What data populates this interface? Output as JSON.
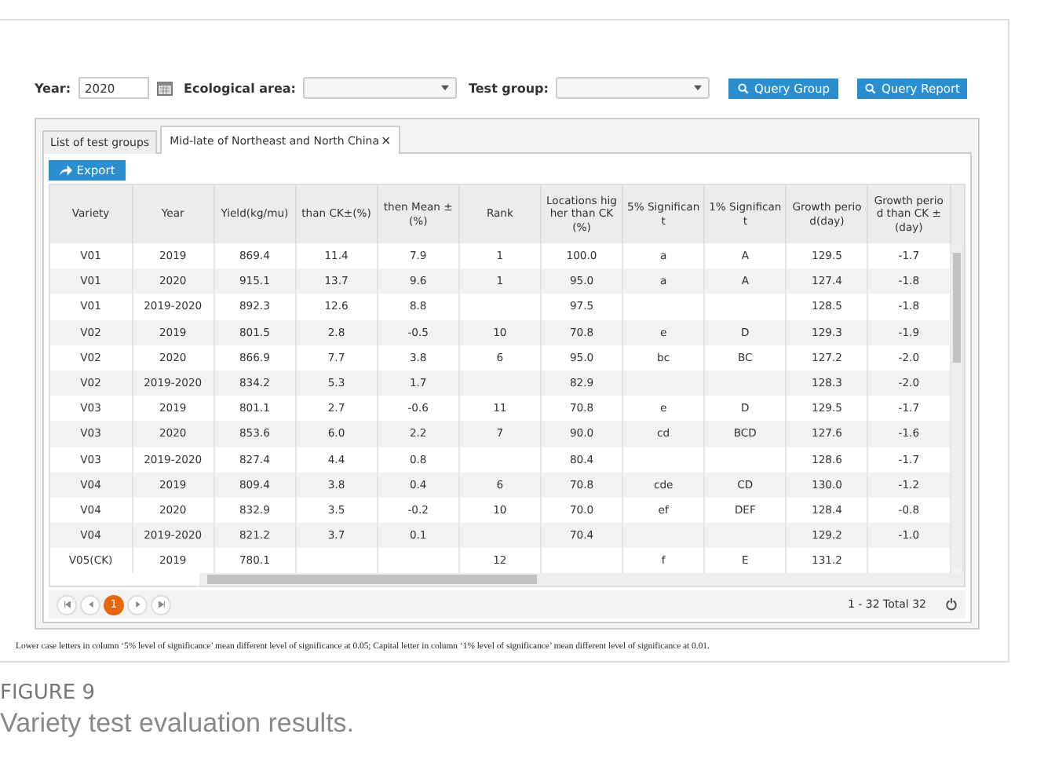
{
  "filters": {
    "year_label": "Year:",
    "year_value": "2020",
    "area_label": "Ecological area:",
    "group_label": "Test group:",
    "buttons": [
      "Query Group",
      "Query Report"
    ]
  },
  "tabs": [
    {
      "label": "List of test groups",
      "selected": false
    },
    {
      "label": "Mid-late of Northeast and North China",
      "selected": true,
      "close": "×"
    }
  ],
  "export_button": "Export",
  "table": {
    "columns": [
      "Variety",
      "Year",
      "Yield(kg/mu)",
      "than CK±(%)",
      "then Mean ±(%)",
      "Rank",
      "Locations higher than CK(%)",
      "5% Significant",
      "1% Significant",
      "Growth period(day)",
      "Growth period than CK ±(day)"
    ],
    "rows": [
      [
        "V01",
        "2019",
        "869.4",
        "11.4",
        "7.9",
        "1",
        "100.0",
        "a",
        "A",
        "129.5",
        "-1.7"
      ],
      [
        "V01",
        "2020",
        "915.1",
        "13.7",
        "9.6",
        "1",
        "95.0",
        "a",
        "A",
        "127.4",
        "-1.8"
      ],
      [
        "V01",
        "2019-2020",
        "892.3",
        "12.6",
        "8.8",
        "",
        "97.5",
        "",
        "",
        "128.5",
        "-1.8"
      ],
      [
        "V02",
        "2019",
        "801.5",
        "2.8",
        "-0.5",
        "10",
        "70.8",
        "e",
        "D",
        "129.3",
        "-1.9"
      ],
      [
        "V02",
        "2020",
        "866.9",
        "7.7",
        "3.8",
        "6",
        "95.0",
        "bc",
        "BC",
        "127.2",
        "-2.0"
      ],
      [
        "V02",
        "2019-2020",
        "834.2",
        "5.3",
        "1.7",
        "",
        "82.9",
        "",
        "",
        "128.3",
        "-2.0"
      ],
      [
        "V03",
        "2019",
        "801.1",
        "2.7",
        "-0.6",
        "11",
        "70.8",
        "e",
        "D",
        "129.5",
        "-1.7"
      ],
      [
        "V03",
        "2020",
        "853.6",
        "6.0",
        "2.2",
        "7",
        "90.0",
        "cd",
        "BCD",
        "127.6",
        "-1.6"
      ],
      [
        "V03",
        "2019-2020",
        "827.4",
        "4.4",
        "0.8",
        "",
        "80.4",
        "",
        "",
        "128.6",
        "-1.7"
      ],
      [
        "V04",
        "2019",
        "809.4",
        "3.8",
        "0.4",
        "6",
        "70.8",
        "cde",
        "CD",
        "130.0",
        "-1.2"
      ],
      [
        "V04",
        "2020",
        "832.9",
        "3.5",
        "-0.2",
        "10",
        "70.0",
        "ef",
        "DEF",
        "128.4",
        "-0.8"
      ],
      [
        "V04",
        "2019-2020",
        "821.2",
        "3.7",
        "0.1",
        "",
        "70.4",
        "",
        "",
        "129.2",
        "-1.0"
      ],
      [
        "V05(CK)",
        "2019",
        "780.1",
        "",
        "",
        "12",
        "",
        "f",
        "E",
        "131.2",
        ""
      ]
    ]
  },
  "pager": {
    "pages": [
      {
        "label": "1",
        "selected": true
      }
    ],
    "summary": "1 - 32 Total 32"
  },
  "footnote": "Lower case letters in column ‘5% level of significance’ mean different level of significance at 0.05; Capital letter in column ‘1% level of significance’ mean different level of significance at 0.01.",
  "figure_label": "FIGURE 9",
  "caption": "Variety test evaluation results."
}
